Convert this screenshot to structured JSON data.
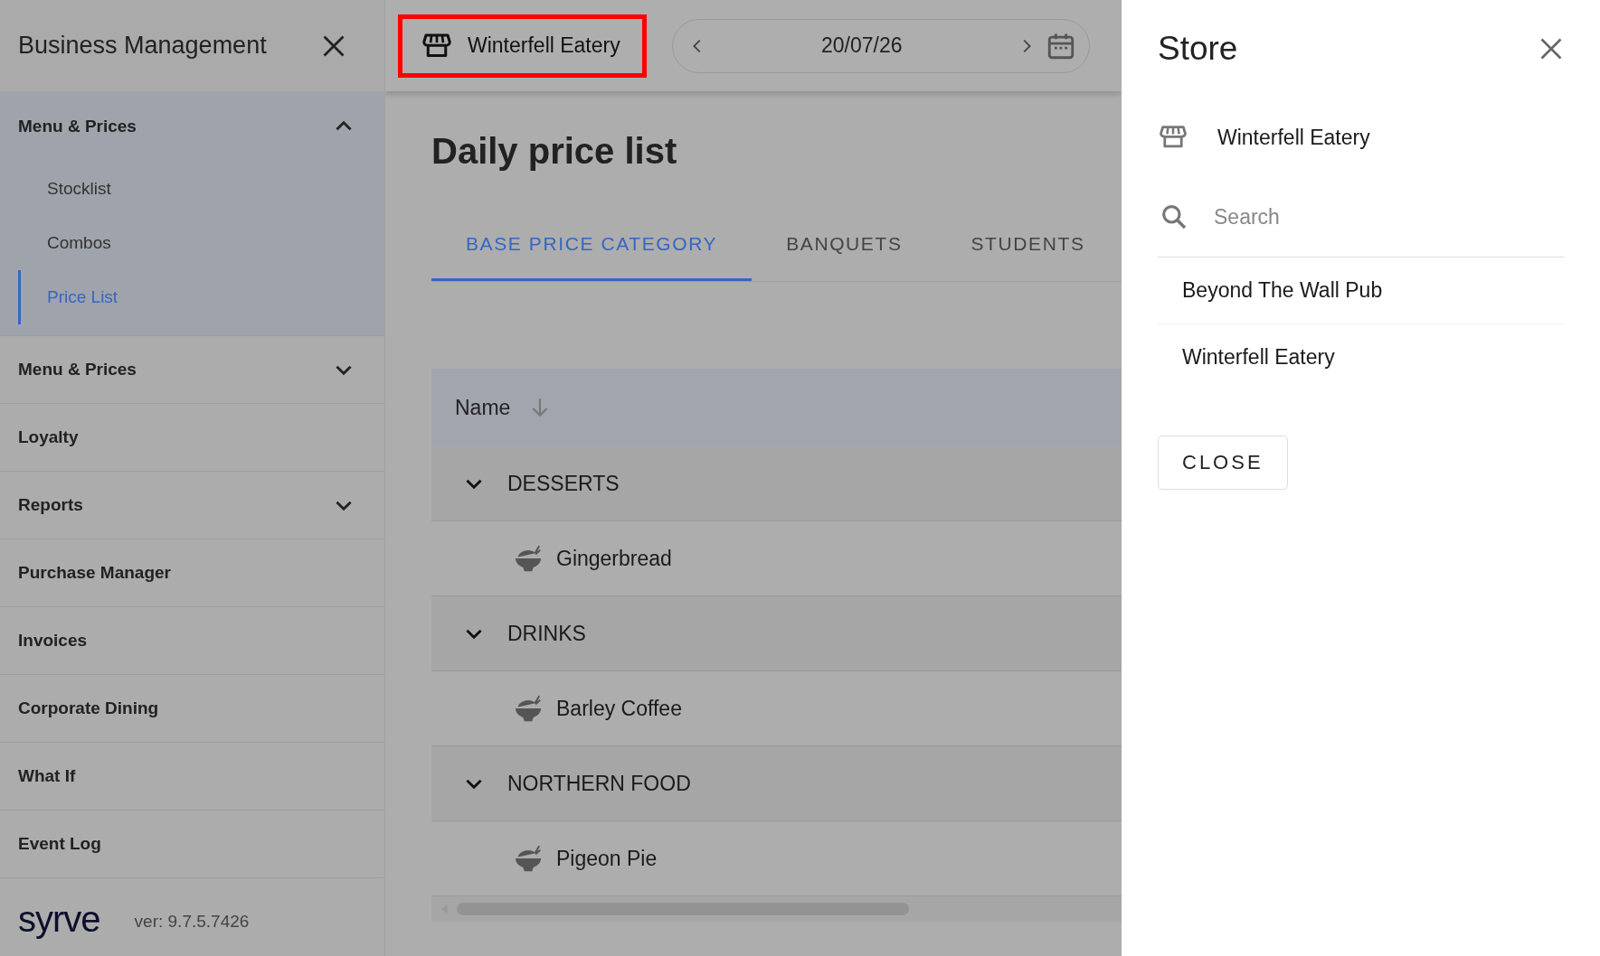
{
  "sidebar": {
    "title": "Business Management",
    "items": [
      {
        "kind": "group",
        "label": "Menu & Prices",
        "expanded": true,
        "children": [
          {
            "label": "Stocklist",
            "selected": false
          },
          {
            "label": "Combos",
            "selected": false
          },
          {
            "label": "Price List",
            "selected": true
          }
        ]
      },
      {
        "kind": "group",
        "label": "Menu & Prices",
        "expanded": false
      },
      {
        "kind": "link",
        "label": "Loyalty"
      },
      {
        "kind": "group",
        "label": "Reports",
        "expanded": false
      },
      {
        "kind": "link",
        "label": "Purchase Manager"
      },
      {
        "kind": "link",
        "label": "Invoices"
      },
      {
        "kind": "link",
        "label": "Corporate Dining"
      },
      {
        "kind": "link",
        "label": "What If"
      },
      {
        "kind": "link",
        "label": "Event Log"
      }
    ],
    "logo": "syrve",
    "version": "ver: 9.7.5.7426"
  },
  "topbar": {
    "store_button": {
      "label": "Winterfell Eatery",
      "highlighted": true
    },
    "date_picker": {
      "date": "20/07/26"
    }
  },
  "page": {
    "title": "Daily price list",
    "tabs": [
      {
        "label": "BASE PRICE CATEGORY",
        "selected": true
      },
      {
        "label": "BANQUETS",
        "selected": false
      },
      {
        "label": "STUDENTS",
        "selected": false
      }
    ],
    "table": {
      "columns": [
        {
          "label": "Name"
        }
      ],
      "rows": [
        {
          "label": "DESSERTS",
          "expanded": true,
          "children": [
            {
              "label": "Gingerbread"
            }
          ]
        },
        {
          "label": "DRINKS",
          "expanded": true,
          "children": [
            {
              "label": "Barley Coffee"
            }
          ]
        },
        {
          "label": "NORTHERN FOOD",
          "expanded": true,
          "children": [
            {
              "label": "Pigeon Pie"
            }
          ]
        }
      ]
    }
  },
  "drawer": {
    "title": "Store",
    "current_store": "Winterfell Eatery",
    "search": {
      "placeholder": "Search"
    },
    "stores": [
      {
        "label": "Beyond The Wall Pub"
      },
      {
        "label": "Winterfell Eatery"
      }
    ],
    "close_button": "CLOSE"
  }
}
